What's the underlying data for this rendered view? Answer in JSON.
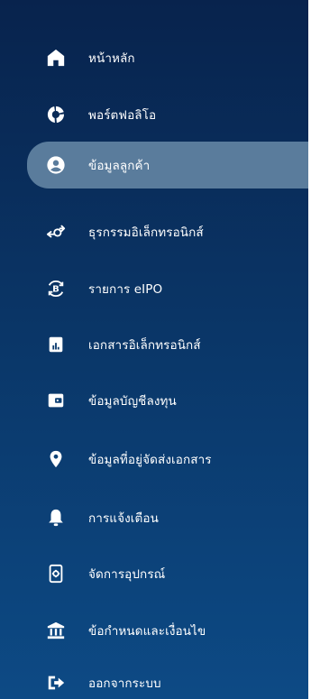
{
  "menu": {
    "items": [
      {
        "label": "หน้าหลัก",
        "icon": "home-icon"
      },
      {
        "label": "พอร์ตฟอลิโอ",
        "icon": "portfolio-pie-icon"
      },
      {
        "label": "ข้อมูลลูกค้า",
        "icon": "user-circle-icon",
        "active": true
      },
      {
        "label": "ธุรกรรมอิเล็กทรอนิกส์",
        "icon": "transfer-arrows-icon"
      },
      {
        "label": "รายการ eIPO",
        "icon": "bitcoin-refresh-icon"
      },
      {
        "label": "เอกสารอิเล็กทรอนิกส์",
        "icon": "report-document-icon"
      },
      {
        "label": "ข้อมูลบัญชีลงทุน",
        "icon": "wallet-icon"
      },
      {
        "label": "ข้อมูลที่อยู่จัดส่งเอกสาร",
        "icon": "location-pin-icon"
      },
      {
        "label": "การแจ้งเตือน",
        "icon": "bell-icon"
      },
      {
        "label": "จัดการอุปกรณ์",
        "icon": "device-settings-icon"
      },
      {
        "label": "ข้อกำหนดและเงื่อนไข",
        "icon": "bank-icon"
      },
      {
        "label": "ออกจากระบบ",
        "icon": "logout-icon"
      }
    ]
  },
  "colors": {
    "background_top": "#08234d",
    "background_bottom": "#0d4a85",
    "active_item": "#5a7c9c",
    "text": "#ffffff"
  }
}
